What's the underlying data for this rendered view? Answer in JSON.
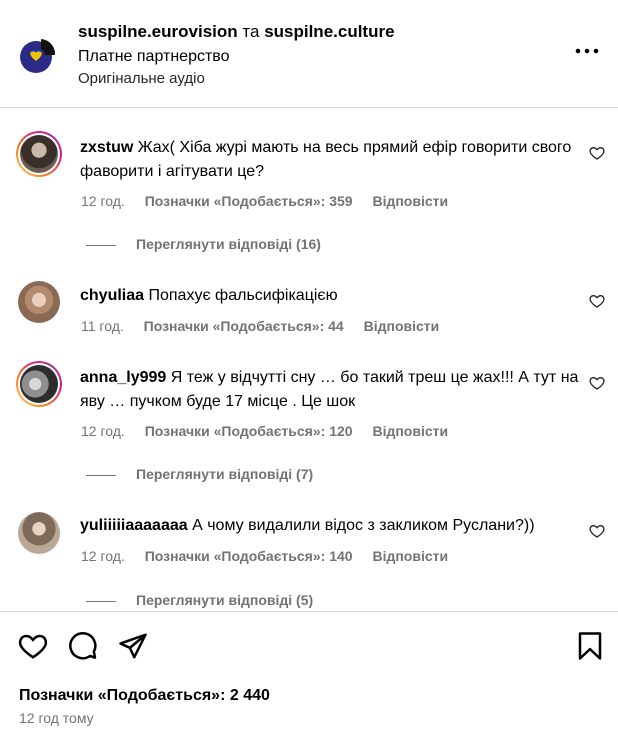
{
  "header": {
    "account1": "suspilne.eurovision",
    "joiner": "та",
    "account2": "suspilne.culture",
    "partnership": "Платне партнерство",
    "audio": "Оригінальне аудіо"
  },
  "comments": [
    {
      "user": "zxstuw",
      "text": "Жах( Хіба журі мають на весь прямий ефір говорити свого фаворити і агітувати це?",
      "time": "12 год.",
      "likes": "Позначки «Подобається»: 359",
      "reply": "Відповісти",
      "view_replies": "Переглянути відповіді (16)"
    },
    {
      "user": "chyuliaa",
      "text": "Попахує фальсифікацією",
      "time": "11 год.",
      "likes": "Позначки «Подобається»: 44",
      "reply": "Відповісти"
    },
    {
      "user": "anna_ly999",
      "text": "Я теж у відчутті сну … бо такий треш це жах!!! А тут на яву … пучком буде 17 місце . Це шок",
      "time": "12 год.",
      "likes": "Позначки «Подобається»: 120",
      "reply": "Відповісти",
      "view_replies": "Переглянути відповіді (7)"
    },
    {
      "user": "yuliiiiiaaaaaaa",
      "text": "А чому видалили відос з закликом Руслани?))",
      "time": "12 год.",
      "likes": "Позначки «Подобається»: 140",
      "reply": "Відповісти",
      "view_replies": "Переглянути відповіді (5)"
    }
  ],
  "footer": {
    "likes_total": "Позначки «Подобається»: 2 440",
    "time_ago": "12 год тому",
    "icons": [
      "heart-icon",
      "comment-icon",
      "share-icon",
      "bookmark-icon"
    ]
  }
}
